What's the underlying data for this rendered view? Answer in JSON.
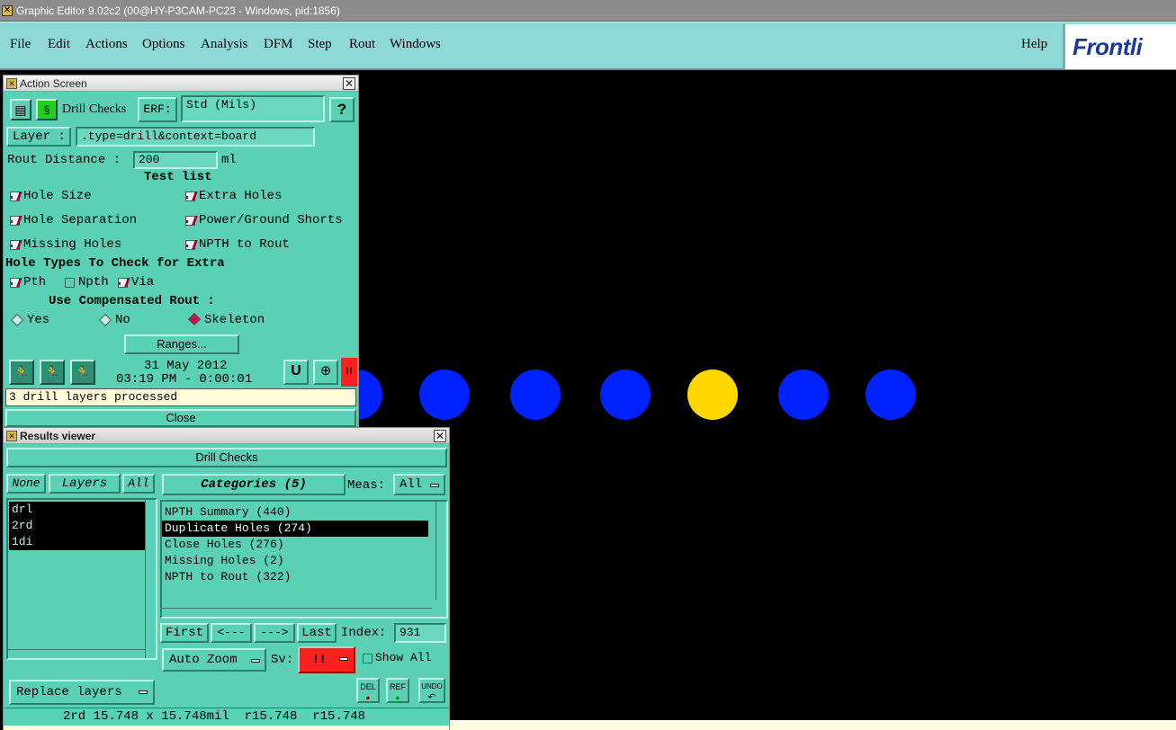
{
  "window": {
    "title": "Graphic Editor 9.02c2 (00@HY-P3CAM-PC23 - Windows, pid:1856)"
  },
  "menubar": {
    "items": [
      "File",
      "Edit",
      "Actions",
      "Options",
      "Analysis",
      "DFM",
      "Step",
      "Rout",
      "Windows"
    ],
    "help": "Help",
    "logo": "Frontli"
  },
  "action_screen": {
    "title": "Action Screen",
    "action_name": "Drill Checks",
    "erf_label": "ERF:",
    "erf_value": "Std (Mils)",
    "help_label": "?",
    "layer_label": "Layer :",
    "layer_value": ".type=drill&context=board",
    "rout_distance_label": "Rout Distance :",
    "rout_distance_value": "200",
    "rout_distance_unit": "ml",
    "test_list_label": "Test list",
    "tests": [
      {
        "label": "Hole Size",
        "checked": true
      },
      {
        "label": "Extra Holes",
        "checked": true
      },
      {
        "label": "Hole Separation",
        "checked": true
      },
      {
        "label": "Power/Ground Shorts",
        "checked": true
      },
      {
        "label": "Missing Holes",
        "checked": true
      },
      {
        "label": "NPTH to Rout",
        "checked": true
      }
    ],
    "hole_types_label": "Hole Types To Check for Extra",
    "hole_types": [
      {
        "label": "Pth",
        "checked": true
      },
      {
        "label": "Npth",
        "checked": false
      },
      {
        "label": "Via",
        "checked": true
      }
    ],
    "compensated_label": "Use Compensated Rout :",
    "compensated_options": [
      {
        "label": "Yes",
        "selected": false
      },
      {
        "label": "No",
        "selected": false
      },
      {
        "label": "Skeleton",
        "selected": true
      }
    ],
    "ranges_button": "Ranges...",
    "date": "31 May 2012",
    "time": "03:19 PM - 0:00:01",
    "status": "3 drill layers processed",
    "close_button": "Close",
    "alert_label": "!!"
  },
  "results_viewer": {
    "title": "Results viewer",
    "header": "Drill Checks",
    "none_label": "None",
    "layers_label": "Layers",
    "all_label": "All",
    "layers": [
      "drl",
      "2rd",
      "1di"
    ],
    "categories_label": "Categories (5)",
    "meas_label": "Meas:",
    "meas_value": "All",
    "categories": [
      {
        "label": "NPTH Summary (440)",
        "selected": false
      },
      {
        "label": "Duplicate Holes (274)",
        "selected": true
      },
      {
        "label": "Close Holes (276)",
        "selected": false
      },
      {
        "label": "Missing Holes (2)",
        "selected": false
      },
      {
        "label": "NPTH to Rout (322)",
        "selected": false
      }
    ],
    "first_button": "First",
    "prev_button": "<---",
    "next_button": "--->",
    "last_button": "Last",
    "index_label": "Index:",
    "index_value": "931",
    "auto_zoom": "Auto Zoom",
    "sv_label": "Sv:",
    "sv_value": "!!",
    "show_all_label": "Show All",
    "show_all_checked": false,
    "replace_layers": "Replace layers",
    "del_label": "DEL",
    "ref_label": "REF",
    "undo_label": "UNDO",
    "measure_line": "2rd 15.748 x 15.748mil  r15.748  r15.748"
  },
  "colors": {
    "panel": "#5ad0b4",
    "menubar": "#8fd8d8",
    "pad": "#0022ff",
    "pad_selected": "#ffd700",
    "alert": "#ff2020"
  }
}
